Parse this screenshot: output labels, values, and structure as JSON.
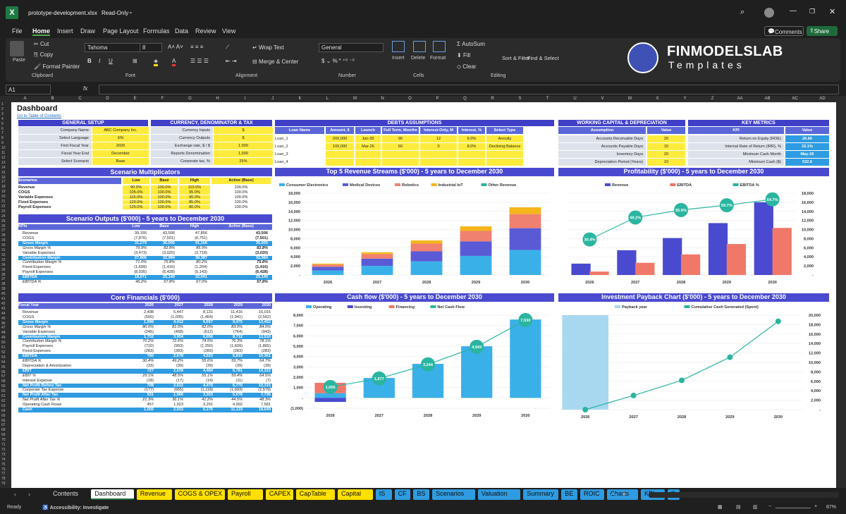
{
  "window": {
    "file_title": "prototype-development.xlsx",
    "mode": "Read-Only",
    "comments": "Comments",
    "share": "Share"
  },
  "menu": [
    "File",
    "Home",
    "Insert",
    "Draw",
    "Page Layout",
    "Formulas",
    "Data",
    "Review",
    "View"
  ],
  "ribbon": {
    "paste": "Paste",
    "cut": "Cut",
    "copy": "Copy",
    "format_painter": "Format Painter",
    "clipboard": "Clipboard",
    "font_name": "Tahoma",
    "font_size": "8",
    "font": "Font",
    "wrap": "Wrap Text",
    "merge": "Merge & Center",
    "alignment": "Alignment",
    "number_format": "General",
    "number": "Number",
    "insert": "Insert",
    "delete": "Delete",
    "format": "Format",
    "cells": "Cells",
    "autosum": "AutoSum",
    "fill": "Fill",
    "clear": "Clear",
    "sort": "Sort & Filter",
    "find": "Find & Select",
    "editing": "Editing",
    "brand1": "FINMODELSLAB",
    "brand2": "Templates"
  },
  "formula_bar": {
    "cell": "A1",
    "fx": "fx"
  },
  "columns": [
    "A",
    "B",
    "C",
    "D",
    "E",
    "F",
    "G",
    "H",
    "I",
    "J",
    "K",
    "L",
    "M",
    "N",
    "O",
    "P",
    "Q",
    "R",
    "S",
    "T",
    "U",
    "V",
    "W",
    "X",
    "Y",
    "Z",
    "AA",
    "AB",
    "AC",
    "AD"
  ],
  "dashboard": {
    "title": "Dashboard",
    "link": "Go to Table of Contents"
  },
  "general": {
    "title": "GENERAL SETUP",
    "rows": [
      [
        "Company Name",
        "ABC Company Inc."
      ],
      [
        "Select Language",
        "EN"
      ],
      [
        "First Fiscal Year",
        "2026"
      ],
      [
        "Fiscal Year End",
        "December"
      ],
      [
        "Select Scenario",
        "Base"
      ]
    ]
  },
  "currency": {
    "title": "CURRENCY, DENOMINATOR & TAX",
    "rows": [
      [
        "Currency Inputs",
        "$"
      ],
      [
        "Currency Outputs",
        "$"
      ],
      [
        "Exchange rate, $ / $",
        "1.000"
      ],
      [
        "Reports Denomination",
        "1,000"
      ],
      [
        "Corporate tax, %",
        "25%"
      ]
    ]
  },
  "debts": {
    "title": "DEBTS ASSUMPTIONS",
    "headers": [
      "Loan Name",
      "Amount, $",
      "Launch",
      "Full Term, Months",
      "Interest-Only, M",
      "Interest, %",
      "Select Type"
    ],
    "rows": [
      [
        "Loan_1",
        "200,000",
        "Jan-26",
        "90",
        "12",
        "6.0%",
        "Annuity"
      ],
      [
        "Loan_2",
        "100,000",
        "Mar-26",
        "60",
        "0",
        "8.0%",
        "Declining Balance"
      ],
      [
        "Loan_3",
        "",
        "",
        "",
        "",
        "",
        ""
      ],
      [
        "Loan_4",
        "",
        "",
        "",
        "",
        "",
        ""
      ]
    ]
  },
  "wc": {
    "title": "WORKING CAPITAL & DEPRECIATION",
    "headers": [
      "Assumption",
      "Value"
    ],
    "rows": [
      [
        "Accounts Receivable Days",
        "20"
      ],
      [
        "Accounts Payable Days",
        "15"
      ],
      [
        "Inventory Days",
        "20"
      ],
      [
        "Depreciation Period (Years)",
        "10"
      ]
    ]
  },
  "kpis": {
    "title": "KEY METRICS",
    "headers": [
      "KPI",
      "Value"
    ],
    "rows": [
      [
        "Return on Equity (ROE)",
        "26.66"
      ],
      [
        "Internal Rate of Return (IRR), %",
        "15.1%"
      ],
      [
        "Minimum Cash Month",
        "May-26"
      ],
      [
        "Minimum Cash ($)",
        "532.6"
      ]
    ]
  },
  "multipliers": {
    "title": "Scenario Multiplicators",
    "headers": [
      "Scenarios",
      "Low",
      "Base",
      "High",
      "Active (Base)"
    ],
    "rows": [
      [
        "Revenue",
        "90.0%",
        "100.0%",
        "110.0%",
        "100.0%"
      ],
      [
        "COGS",
        "105.0%",
        "100.0%",
        "95.0%",
        "100.0%"
      ],
      [
        "Variable Expenses",
        "115.0%",
        "100.0%",
        "90.0%",
        "100.0%"
      ],
      [
        "Fixed Expenses",
        "120.0%",
        "100.0%",
        "85.0%",
        "100.0%"
      ],
      [
        "Payroll Expenses",
        "125.0%",
        "100.0%",
        "80.0%",
        "100.0%"
      ]
    ]
  },
  "outputs": {
    "title": "Scenario Outputs ($'000) - 5 years to December 2030",
    "headers": [
      "KPIs",
      "Low",
      "Base",
      "High",
      "Active (Base)"
    ],
    "rows": [
      [
        "Revenue",
        "39,155",
        "43,506",
        "47,856",
        "43,506"
      ],
      [
        "COGS",
        "(7,876)",
        "(7,501)",
        "(6,751)",
        "(7,501)"
      ],
      [
        "Gross Margin",
        "31,279",
        "36,005",
        "41,106",
        "36,005"
      ],
      [
        "Gross Margin %",
        "79.9%",
        "82.8%",
        "85.9%",
        "82.8%"
      ],
      [
        "Variable Expenses",
        "(3,473)",
        "(3,020)",
        "(2,718)",
        "(3,020)"
      ],
      [
        "Contribution Margin",
        "27,806",
        "32,984",
        "38,387",
        "32,984"
      ],
      [
        "Contribution Margin %",
        "71.0%",
        "75.8%",
        "80.2%",
        "75.8%"
      ],
      [
        "Fixed Expenses",
        "(1,699)",
        "(1,416)",
        "(1,204)",
        "(1,416)"
      ],
      [
        "Payroll Expenses",
        "(8,035)",
        "(6,428)",
        "(5,143)",
        "(6,428)"
      ],
      [
        "EBITDA",
        "18,071",
        "25,140",
        "32,041",
        "25,140"
      ],
      [
        "EBITDA %",
        "46.2%",
        "57.8%",
        "67.0%",
        "57.8%"
      ]
    ]
  },
  "core": {
    "title": "Core Financials ($'000)",
    "headers": [
      "Fiscal Year",
      "2026",
      "2027",
      "2028",
      "2029",
      "2030"
    ],
    "rows": [
      [
        "Revenue",
        "2,498",
        "5,447",
        "8,131",
        "11,416",
        "16,015"
      ],
      [
        "COGS",
        "(500)",
        "(1,035)",
        "(1,464)",
        "(1,941)",
        "(2,562)"
      ],
      [
        "Gross Margin",
        "1,998",
        "4,412",
        "6,667",
        "9,475",
        "13,452"
      ],
      [
        "Gross Margin %",
        "80.0%",
        "81.0%",
        "82.0%",
        "83.0%",
        "84.0%"
      ],
      [
        "Variable Expenses",
        "(245)",
        "(458)",
        "(612)",
        "(764)",
        "(943)"
      ],
      [
        "Contribution Margin",
        "1,752",
        "3,954",
        "6,056",
        "8,712",
        "12,510"
      ],
      [
        "Contribution Margin %",
        "70.2%",
        "72.6%",
        "74.5%",
        "76.3%",
        "78.1%"
      ],
      [
        "Payroll Expenses",
        "(710)",
        "(993)",
        "(1,250)",
        "(1,609)",
        "(1,865)"
      ],
      [
        "Fixed Expenses",
        "(283)",
        "(283)",
        "(283)",
        "(283)",
        "(283)"
      ],
      [
        "EBITDA",
        "760",
        "2,678",
        "4,523",
        "6,819",
        "10,361"
      ],
      [
        "EBITDA %",
        "30.4%",
        "49.2%",
        "55.6%",
        "59.7%",
        "64.7%"
      ],
      [
        "Depreciation & Amortization",
        "(33)",
        "(39)",
        "(39)",
        "(39)",
        "(39)"
      ],
      [
        "EBIT",
        "727",
        "2,639",
        "4,484",
        "6,781",
        "10,322"
      ],
      [
        "EBIT %",
        "29.1%",
        "48.5%",
        "55.1%",
        "59.4%",
        "64.5%"
      ],
      [
        "Interest Expense",
        "(18)",
        "(17)",
        "(14)",
        "(11)",
        "(7)"
      ],
      [
        "Net Profit Before Tax",
        "708",
        "2,622",
        "4,470",
        "6,770",
        "10,315"
      ],
      [
        "Corporate Tax Expense",
        "(177)",
        "(655)",
        "(1,118)",
        "(1,693)",
        "(2,579)"
      ],
      [
        "Net Profit After Tax",
        "531",
        "1,966",
        "3,353",
        "5,078",
        "7,736"
      ],
      [
        "Net Profit After Tax %",
        "21.3%",
        "36.1%",
        "41.2%",
        "44.5%",
        "48.3%"
      ],
      [
        "Operating Cash Flows",
        "457",
        "1,923",
        "3,291",
        "4,992",
        "7,581"
      ],
      [
        "Cash",
        "1,056",
        "2,933",
        "6,176",
        "11,119",
        "18,649"
      ]
    ]
  },
  "charts": {
    "revenue_streams": {
      "type": "bar",
      "title": "Top 5 Revenue Streams ($'000) - 5 years to December 2030",
      "categories": [
        "2026",
        "2027",
        "2028",
        "2029",
        "2030"
      ],
      "series": [
        {
          "name": "Consumer Electronics",
          "values": [
            1000,
            2000,
            3000,
            4200,
            5500
          ],
          "color": "#3ab0e8"
        },
        {
          "name": "Medical Devices",
          "values": [
            800,
            1600,
            2200,
            3200,
            4800
          ],
          "color": "#5a5ad6"
        },
        {
          "name": "Robotics",
          "values": [
            500,
            1000,
            1700,
            2300,
            3100
          ],
          "color": "#f08070"
        },
        {
          "name": "Industrial IoT",
          "values": [
            200,
            400,
            700,
            1000,
            1500
          ],
          "color": "#f5b61b"
        },
        {
          "name": "Other Revenue",
          "values": [
            0,
            0,
            0,
            0,
            0
          ],
          "color": "#2ab5a0"
        }
      ],
      "ylim": [
        0,
        18000
      ],
      "yticks": [
        "18,000",
        "16,000",
        "14,000",
        "12,000",
        "10,000",
        "8,000",
        "6,000",
        "4,000",
        "2,000",
        "-"
      ]
    },
    "profitability": {
      "type": "bar",
      "title": "Profitability ($'000) - 5 years to December 2030",
      "categories": [
        "2026",
        "2027",
        "2028",
        "2029",
        "2030"
      ],
      "series": [
        {
          "name": "Revenue",
          "values": [
            2498,
            5447,
            8131,
            11416,
            16015
          ],
          "color": "#4a4ad0"
        },
        {
          "name": "EBITDA",
          "values": [
            760,
            2678,
            4523,
            6819,
            10361
          ],
          "color": "#f07868"
        },
        {
          "name": "EBITDA %",
          "values": [
            30.4,
            49.2,
            55.6,
            59.7,
            64.7
          ],
          "color": "#2ab5a0"
        }
      ],
      "ylim": [
        0,
        18000
      ],
      "yticks": [
        "18,000",
        "16,000",
        "14,000",
        "12,000",
        "10,000",
        "8,000",
        "6,000",
        "4,000",
        "2,000",
        "-"
      ],
      "labels": [
        "30.4%",
        "49.2%",
        "55.6%",
        "59.7%",
        "64.7%"
      ]
    },
    "cashflow": {
      "type": "bar",
      "title": "Cash flow ($'000) - 5 years to December 2030",
      "categories": [
        "2026",
        "2027",
        "2028",
        "2029",
        "2030"
      ],
      "series": [
        {
          "name": "Operating",
          "values": [
            457,
            1923,
            3291,
            4992,
            7581
          ],
          "color": "#3ab0e8"
        },
        {
          "name": "Investing",
          "values": [
            -390,
            0,
            0,
            0,
            0
          ],
          "color": "#4a4ad0"
        },
        {
          "name": "Financing",
          "values": [
            1000,
            0,
            0,
            0,
            0
          ],
          "color": "#f07868"
        },
        {
          "name": "Net Cash Flow",
          "values": [
            1056,
            1877,
            3244,
            4943,
            7530
          ],
          "color": "#2ab5a0"
        }
      ],
      "ylim": [
        -1000,
        8000
      ],
      "yticks": [
        "8,000",
        "7,000",
        "6,000",
        "5,000",
        "4,000",
        "3,000",
        "2,000",
        "1,000",
        "-",
        "(1,000)"
      ],
      "labels": [
        "1,056",
        "1,877",
        "3,244",
        "4,943",
        "7,530"
      ]
    },
    "payback": {
      "type": "line",
      "title": "Investment Payback Chart ($'000) - 5 years to December 2030",
      "categories": [
        "2026",
        "2027",
        "2028",
        "2029",
        "2030"
      ],
      "series": [
        {
          "name": "Payback year",
          "values": [
            1,
            0,
            0,
            0,
            0
          ],
          "color": "#a8d8f0"
        },
        {
          "name": "Cumulative Cash Generated (Spent)",
          "values": [
            0,
            3000,
            6200,
            11100,
            18700
          ],
          "color": "#2ab5a0"
        }
      ],
      "ylim": [
        0,
        20000
      ],
      "yticks": [
        "20,000",
        "18,000",
        "16,000",
        "14,000",
        "12,000",
        "10,000",
        "8,000",
        "6,000",
        "4,000",
        "2,000",
        "-"
      ]
    }
  },
  "tabs": [
    {
      "label": "Contents",
      "color": ""
    },
    {
      "label": "Dashboard",
      "color": "#ffffff",
      "active": true
    },
    {
      "label": "Revenue",
      "color": "#ffe000"
    },
    {
      "label": "COGS & OPEX",
      "color": "#ffe000"
    },
    {
      "label": "Payroll",
      "color": "#ffe000"
    },
    {
      "label": "CAPEX",
      "color": "#ffe000"
    },
    {
      "label": "CapTable",
      "color": "#ffe000"
    },
    {
      "label": "Capital",
      "color": "#ffe000"
    },
    {
      "label": "IS",
      "color": "#2f9be0"
    },
    {
      "label": "CF",
      "color": "#2f9be0"
    },
    {
      "label": "BS",
      "color": "#2f9be0"
    },
    {
      "label": "Scenarios",
      "color": "#2f9be0"
    },
    {
      "label": "Valuation",
      "color": "#2f9be0"
    },
    {
      "label": "Summary",
      "color": "#2f9be0"
    },
    {
      "label": "BE",
      "color": "#2f9be0"
    },
    {
      "label": "ROIC",
      "color": "#2f9be0"
    },
    {
      "label": "Charts",
      "color": "#2f9be0"
    },
    {
      "label": "KPIs",
      "color": "#2f9be0"
    },
    {
      "label": "S",
      "color": "#2f9be0"
    }
  ],
  "status": {
    "ready": "Ready",
    "access": "Accessibility: Investigate",
    "zoom": "87%"
  }
}
